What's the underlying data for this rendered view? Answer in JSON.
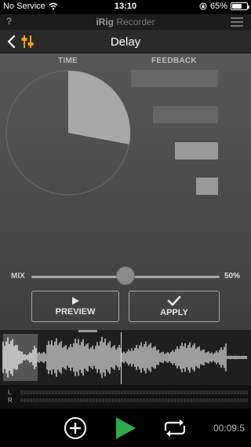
{
  "status_bar": {
    "carrier": "No Service",
    "time": "13:10",
    "battery_text": "65%",
    "battery_level": 0.65
  },
  "app_bar": {
    "help_label": "?",
    "title_bold": "iRig",
    "title_rest": " Recorder"
  },
  "nav_bar": {
    "title": "Delay"
  },
  "delay": {
    "time_label": "TIME",
    "feedback_label": "FEEDBACK",
    "time_value": 0.28,
    "feedback_level": 0.55,
    "mix_label": "MIX",
    "mix_value": "50%",
    "mix_level": 0.5
  },
  "actions": {
    "preview_label": "PREVIEW",
    "apply_label": "APPLY"
  },
  "meter": {
    "left_label": "L",
    "right_label": "R"
  },
  "transport": {
    "elapsed": "00:09.5"
  },
  "colors": {
    "play_green": "#2ea84a",
    "accent_orange": "#f0a020"
  },
  "icons": [
    "wifi-icon",
    "lock-rotation-icon",
    "battery-icon",
    "menu-icon",
    "back-icon",
    "mixer-icon",
    "play-icon",
    "check-icon",
    "add-icon",
    "loop-icon"
  ]
}
